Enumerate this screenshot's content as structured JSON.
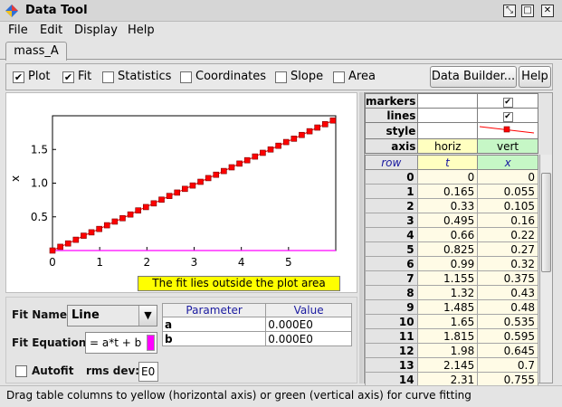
{
  "window": {
    "title": "Data Tool",
    "controls": [
      "restore-icon",
      "maximize-icon",
      "close-icon"
    ]
  },
  "menu": [
    "File",
    "Edit",
    "Display",
    "Help"
  ],
  "tab": {
    "label": "mass_A"
  },
  "toolbar": {
    "checks": [
      {
        "label": "Plot",
        "checked": true
      },
      {
        "label": "Fit",
        "checked": true
      },
      {
        "label": "Statistics",
        "checked": false
      },
      {
        "label": "Coordinates",
        "checked": false
      },
      {
        "label": "Slope",
        "checked": false
      },
      {
        "label": "Area",
        "checked": false
      }
    ],
    "data_builder": "Data Builder...",
    "help": "Help"
  },
  "plot": {
    "ylabel": "x",
    "xticks": [
      "0",
      "1",
      "2",
      "3",
      "4",
      "5"
    ],
    "yticks": [
      "0.5",
      "1.0",
      "1.5"
    ],
    "message": "The fit lies outside the plot area",
    "message_bg": "#ffff00",
    "marker_color": "#ff0000",
    "fit_line_color": "#ff00ff"
  },
  "chart_data": {
    "type": "scatter",
    "xlabel": "",
    "ylabel": "x",
    "xlim": [
      0,
      6
    ],
    "ylim": [
      0,
      2
    ],
    "series": [
      {
        "x": [
          0,
          0.165,
          0.33,
          0.495,
          0.66,
          0.825,
          0.99,
          1.155,
          1.32,
          1.485,
          1.65,
          1.815,
          1.98,
          2.145,
          2.31,
          2.475,
          2.64,
          2.805,
          2.97,
          3.135,
          3.3,
          3.465,
          3.63,
          3.795,
          3.96,
          4.125,
          4.29,
          4.455,
          4.62,
          4.785,
          4.95,
          5.115,
          5.28,
          5.445,
          5.61,
          5.775,
          5.94
        ],
        "y": [
          0,
          0.055,
          0.105,
          0.16,
          0.22,
          0.27,
          0.32,
          0.375,
          0.43,
          0.48,
          0.535,
          0.595,
          0.645,
          0.7,
          0.755,
          0.81,
          0.86,
          0.915,
          0.965,
          1.02,
          1.075,
          1.125,
          1.18,
          1.235,
          1.29,
          1.34,
          1.395,
          1.45,
          1.5,
          1.555,
          1.61,
          1.66,
          1.715,
          1.77,
          1.825,
          1.875,
          1.93
        ]
      }
    ]
  },
  "fit": {
    "name_label": "Fit Name:",
    "name_value": "Line",
    "equation_label": "Fit Equation:",
    "equation_value": "= a*t + b",
    "autofit_label": "Autofit",
    "rms_label": "rms dev:",
    "rms_value": "E0",
    "params_header": [
      "Parameter",
      "Value"
    ],
    "params": [
      {
        "name": "a",
        "value": "0.000E0"
      },
      {
        "name": "b",
        "value": "0.000E0"
      }
    ]
  },
  "props": {
    "markers": "markers",
    "lines": "lines",
    "style": "style",
    "axis": "axis",
    "horiz": "horiz",
    "vert": "vert"
  },
  "table": {
    "headers": [
      "row",
      "t",
      "x"
    ],
    "rows": [
      [
        "0",
        "0",
        "0"
      ],
      [
        "1",
        "0.165",
        "0.055"
      ],
      [
        "2",
        "0.33",
        "0.105"
      ],
      [
        "3",
        "0.495",
        "0.16"
      ],
      [
        "4",
        "0.66",
        "0.22"
      ],
      [
        "5",
        "0.825",
        "0.27"
      ],
      [
        "6",
        "0.99",
        "0.32"
      ],
      [
        "7",
        "1.155",
        "0.375"
      ],
      [
        "8",
        "1.32",
        "0.43"
      ],
      [
        "9",
        "1.485",
        "0.48"
      ],
      [
        "10",
        "1.65",
        "0.535"
      ],
      [
        "11",
        "1.815",
        "0.595"
      ],
      [
        "12",
        "1.98",
        "0.645"
      ],
      [
        "13",
        "2.145",
        "0.7"
      ],
      [
        "14",
        "2.31",
        "0.755"
      ]
    ]
  },
  "status": "Drag table columns to yellow (horizontal axis) or green (vertical axis) for curve fitting"
}
